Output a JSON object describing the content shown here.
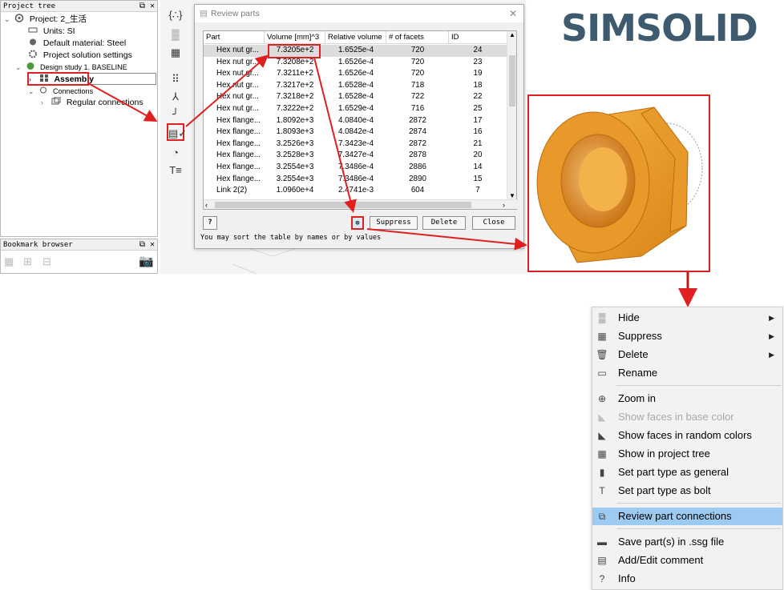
{
  "project_tree": {
    "title": "Project tree",
    "items": [
      {
        "label": "Project: 2_生活"
      },
      {
        "label": "Units: SI"
      },
      {
        "label": "Default material: Steel"
      },
      {
        "label": "Project solution settings"
      },
      {
        "label": "Design study 1. BASELINE"
      },
      {
        "label": "Assembly"
      },
      {
        "label": "Connections"
      },
      {
        "label": "Regular connections"
      }
    ]
  },
  "bookmark_browser": {
    "title": "Bookmark browser"
  },
  "review_dialog": {
    "title": "Review parts",
    "columns": [
      "Part",
      "Volume [mm]^3",
      "Relative volume",
      "# of facets",
      "ID"
    ],
    "rows": [
      [
        "Hex nut gr...",
        "7.3205e+2",
        "1.6525e-4",
        "720",
        "24"
      ],
      [
        "Hex nut gr...",
        "7.3208e+2",
        "1.6526e-4",
        "720",
        "23"
      ],
      [
        "Hex nut gr...",
        "7.3211e+2",
        "1.6526e-4",
        "720",
        "19"
      ],
      [
        "Hex nut gr...",
        "7.3217e+2",
        "1.6528e-4",
        "718",
        "18"
      ],
      [
        "Hex nut gr...",
        "7.3218e+2",
        "1.6528e-4",
        "722",
        "22"
      ],
      [
        "Hex nut gr...",
        "7.3222e+2",
        "1.6529e-4",
        "716",
        "25"
      ],
      [
        "Hex flange...",
        "1.8092e+3",
        "4.0840e-4",
        "2872",
        "17"
      ],
      [
        "Hex flange...",
        "1.8093e+3",
        "4.0842e-4",
        "2874",
        "16"
      ],
      [
        "Hex flange...",
        "3.2526e+3",
        "7.3423e-4",
        "2872",
        "21"
      ],
      [
        "Hex flange...",
        "3.2528e+3",
        "7.3427e-4",
        "2878",
        "20"
      ],
      [
        "Hex flange...",
        "3.2554e+3",
        "7.3486e-4",
        "2886",
        "14"
      ],
      [
        "Hex flange...",
        "3.2554e+3",
        "7.3486e-4",
        "2890",
        "15"
      ],
      [
        "Link 2(2)",
        "1.0960e+4",
        "2.4741e-3",
        "604",
        "7"
      ]
    ],
    "help_label": "?",
    "suppress_label": "Suppress",
    "delete_label": "Delete",
    "close_label": "Close",
    "hint": "You may sort the table by names or by values"
  },
  "logo": {
    "text": "SIMSOLID"
  },
  "context_menu": {
    "items": [
      {
        "label": "Hide",
        "submenu": true
      },
      {
        "label": "Suppress",
        "submenu": true
      },
      {
        "label": "Delete",
        "submenu": true
      },
      {
        "label": "Rename"
      },
      {
        "label": "Zoom in"
      },
      {
        "label": "Show faces in base color",
        "disabled": true
      },
      {
        "label": "Show faces in random colors"
      },
      {
        "label": "Show in project tree"
      },
      {
        "label": "Set part type as general"
      },
      {
        "label": "Set part type as bolt"
      },
      {
        "label": "Review part connections",
        "highlighted": true
      },
      {
        "label": "Save part(s) in .ssg file"
      },
      {
        "label": "Add/Edit comment"
      },
      {
        "label": "Info"
      }
    ]
  },
  "colors": {
    "highlight_red": "#e02020",
    "menu_highlight": "#9dcaf0",
    "nut_orange": "#f0a030",
    "logo": "#3e5a6e"
  }
}
